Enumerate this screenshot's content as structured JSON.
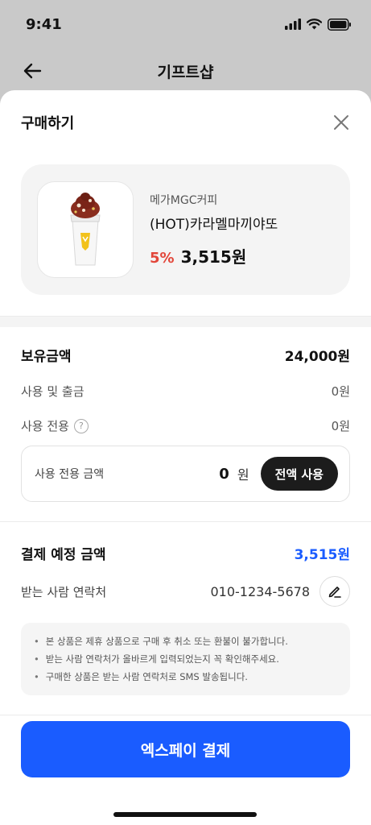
{
  "status_bar": {
    "time": "9:41"
  },
  "nav": {
    "title": "기프트샵"
  },
  "sheet": {
    "title": "구매하기"
  },
  "product": {
    "brand": "메가MGC커피",
    "name": "(HOT)카라멜마끼야또",
    "discount": "5%",
    "price": "3,515원"
  },
  "balance": {
    "holding_label": "보유금액",
    "holding_value": "24,000원",
    "use_withdraw_label": "사용 및 출금",
    "use_withdraw_value": "0원",
    "dedicated_label": "사용 전용",
    "dedicated_value": "0원",
    "dedicated_amount_label": "사용 전용 금액",
    "dedicated_amount_value": "0",
    "dedicated_amount_unit": "원",
    "use_all_button": "전액 사용"
  },
  "payment": {
    "expected_label": "결제 예정 금액",
    "expected_value": "3,515원",
    "recipient_label": "받는 사람 연락처",
    "recipient_phone": "010-1234-5678"
  },
  "notices": [
    "본 상품은 제휴 상품으로 구매 후 취소 또는 환불이 불가합니다.",
    "받는 사람 연락처가 올바르게 입력되었는지 꼭 확인해주세요.",
    "구매한 상품은 받는 사람 연락처로 SMS 발송됩니다."
  ],
  "pay_button": "엑스페이 결제",
  "colors": {
    "accent": "#1a5cff",
    "discount": "#e2463a"
  }
}
